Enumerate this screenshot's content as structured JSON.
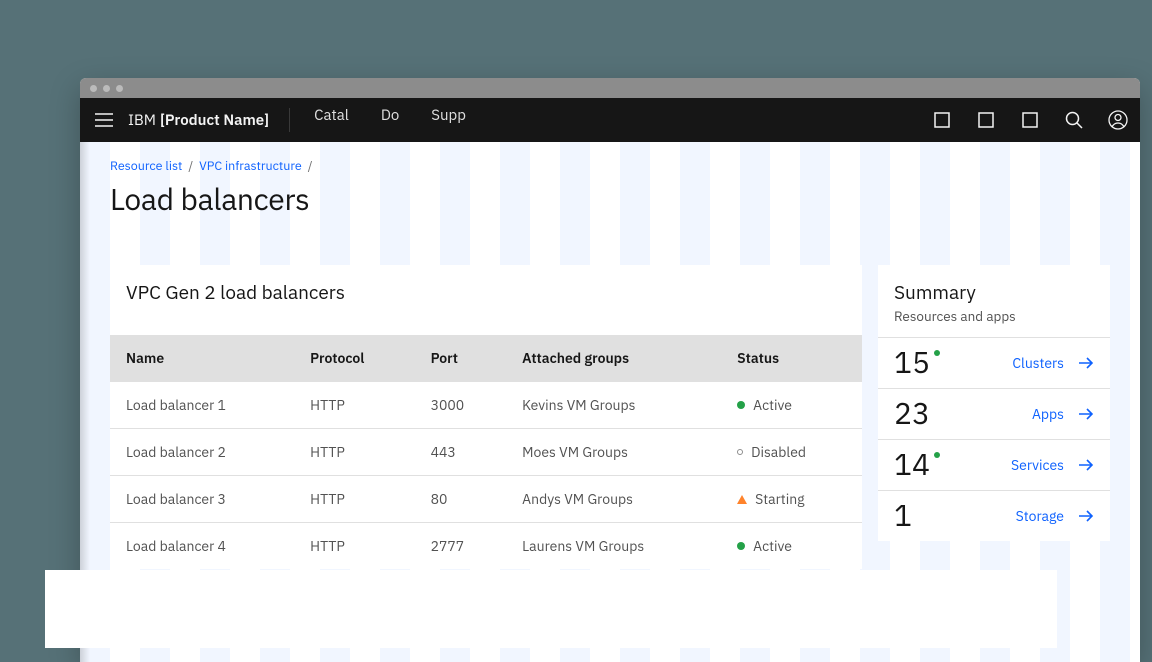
{
  "header": {
    "brand_thin": "IBM",
    "brand_bold": "[Product Name]",
    "nav": [
      "Catal",
      "Do",
      "Supp"
    ]
  },
  "breadcrumb": {
    "items": [
      "Resource list",
      "VPC infrastructure"
    ],
    "sep": "/"
  },
  "page_title": "Load balancers",
  "main": {
    "title": "VPC Gen 2 load balancers",
    "columns": [
      "Name",
      "Protocol",
      "Port",
      "Attached groups",
      "Status"
    ],
    "rows": [
      {
        "name": "Load balancer 1",
        "protocol": "HTTP",
        "port": "3000",
        "group": "Kevins VM Groups",
        "status": "Active",
        "status_kind": "active"
      },
      {
        "name": "Load balancer 2",
        "protocol": "HTTP",
        "port": "443",
        "group": "Moes VM Groups",
        "status": "Disabled",
        "status_kind": "disabled"
      },
      {
        "name": "Load balancer 3",
        "protocol": "HTTP",
        "port": "80",
        "group": "Andys VM Groups",
        "status": "Starting",
        "status_kind": "starting"
      },
      {
        "name": "Load balancer 4",
        "protocol": "HTTP",
        "port": "2777",
        "group": "Laurens VM Groups",
        "status": "Active",
        "status_kind": "active"
      }
    ]
  },
  "summary": {
    "title": "Summary",
    "subtitle": "Resources and apps",
    "items": [
      {
        "count": "15",
        "label": "Clusters",
        "badge": true
      },
      {
        "count": "23",
        "label": "Apps",
        "badge": false
      },
      {
        "count": "14",
        "label": "Services",
        "badge": true
      },
      {
        "count": "1",
        "label": "Storage",
        "badge": false
      }
    ]
  }
}
